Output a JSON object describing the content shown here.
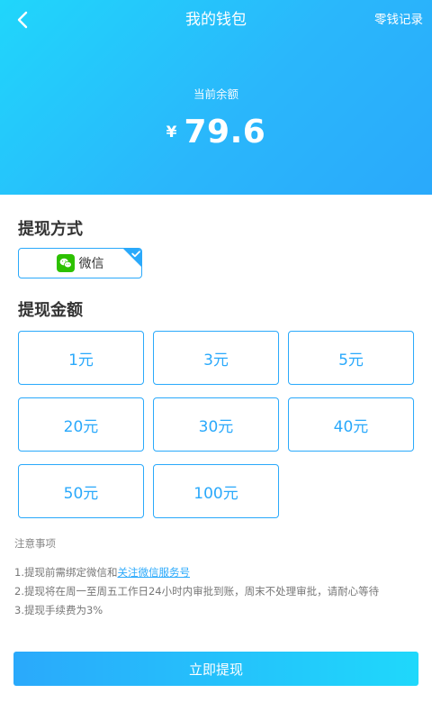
{
  "header": {
    "title": "我的钱包",
    "history_link": "零钱记录",
    "balance_label": "当前余额",
    "currency_symbol": "¥",
    "balance_amount": "79.6"
  },
  "withdraw_method": {
    "title": "提现方式",
    "selected": "微信"
  },
  "withdraw_amount": {
    "title": "提现金额",
    "options": [
      "1元",
      "3元",
      "5元",
      "20元",
      "30元",
      "40元",
      "50元",
      "100元"
    ]
  },
  "notes": {
    "title": "注意事项",
    "line1_text": "1.提现前需绑定微信和",
    "line1_link": "关注微信服务号",
    "line2": "2.提现将在周一至周五工作日24小时内审批到账，周末不处理审批，请耐心等待",
    "line3": "3.提现手续费为3%"
  },
  "submit_label": "立即提现",
  "colors": {
    "accent": "#2aa9fb",
    "header_gradient_start": "#20d6fb",
    "wechat_green": "#2dc100"
  },
  "icons": {
    "back": "chevron-left-icon",
    "wechat": "wechat-icon",
    "selected": "check-icon"
  }
}
